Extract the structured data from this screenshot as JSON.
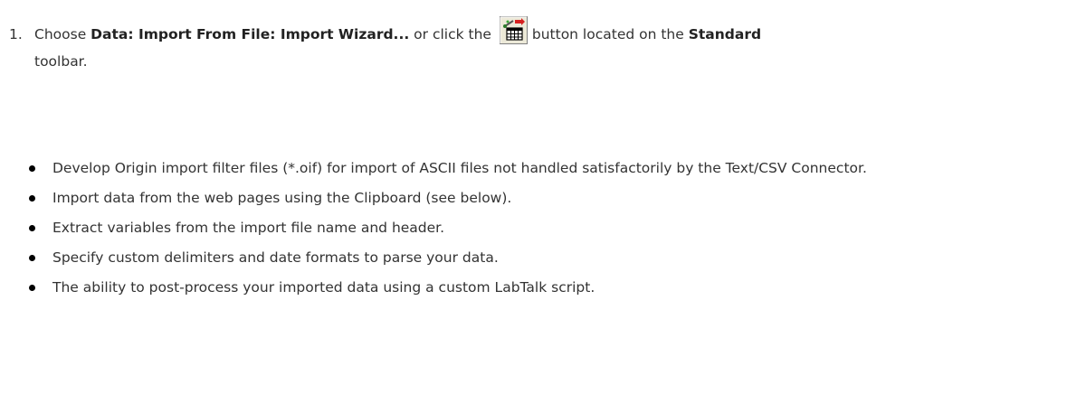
{
  "step": {
    "number": "1.",
    "text_choose": "Choose ",
    "menu_path": "Data: Import From File: Import Wizard...",
    "text_or_click": " or click the ",
    "button_icon": "import-wizard-icon",
    "text_button_located": "button located on the ",
    "toolbar_name": "Standard",
    "text_toolbar": "toolbar."
  },
  "bullets": [
    "Develop Origin import filter files (*.oif) for import of ASCII files not handled satisfactorily by the Text/CSV Connector.",
    "Import data from the web pages using the Clipboard (see below).",
    "Extract variables from the import file name and header.",
    "Specify custom delimiters and date formats to parse your data.",
    "The ability to post-process your imported data using a custom LabTalk script."
  ]
}
